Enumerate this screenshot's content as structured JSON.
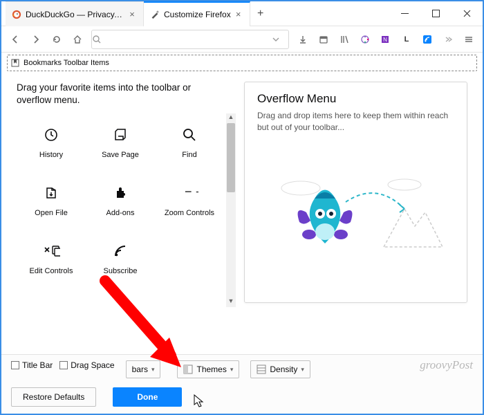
{
  "tabs": [
    {
      "label": "DuckDuckGo — Privacy, sim",
      "active": false,
      "favicon": "duck"
    },
    {
      "label": "Customize Firefox",
      "active": true,
      "favicon": "brush"
    }
  ],
  "bookmarks_bar_label": "Bookmarks Toolbar Items",
  "customize": {
    "instruction": "Drag your favorite items into the toolbar or overflow menu.",
    "items": [
      {
        "icon": "history",
        "label": "History"
      },
      {
        "icon": "save",
        "label": "Save Page"
      },
      {
        "icon": "find",
        "label": "Find"
      },
      {
        "icon": "open",
        "label": "Open File"
      },
      {
        "icon": "addons",
        "label": "Add-ons"
      },
      {
        "icon": "zoom",
        "label": "Zoom Controls"
      },
      {
        "icon": "edit",
        "label": "Edit Controls"
      },
      {
        "icon": "subscribe",
        "label": "Subscribe"
      }
    ]
  },
  "overflow": {
    "title": "Overflow Menu",
    "description": "Drag and drop items here to keep them within reach but out of your toolbar..."
  },
  "footer": {
    "title_bar": "Title Bar",
    "drag_space": "Drag Space",
    "toolbars": "bars",
    "themes": "Themes",
    "density": "Density",
    "restore": "Restore Defaults",
    "done": "Done"
  },
  "watermark": "groovyPost"
}
